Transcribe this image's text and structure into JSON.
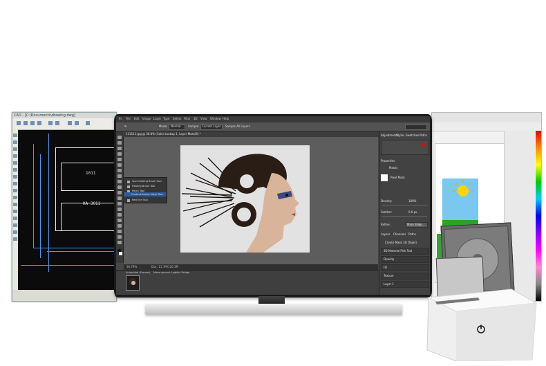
{
  "photoshop": {
    "menu": [
      "File",
      "Edit",
      "Image",
      "Layer",
      "Type",
      "Select",
      "Filter",
      "3D",
      "View",
      "Window",
      "Help"
    ],
    "options": {
      "mode_label": "Mode:",
      "mode_value": "Normal",
      "sample_label": "Sample:",
      "sample_value": "Current Layer",
      "checkbox_label": "Sample All Layers"
    },
    "tab_title": "111111.jpg @ 36.8% (Color Lookup 1, Layer Mask/8) *",
    "tool_flyout": [
      "Spot Healing Brush Tool",
      "Healing Brush Tool",
      "Patch Tool",
      "Content-Aware Move Tool",
      "Red Eye Tool"
    ],
    "status": {
      "zoom": "36.79%",
      "doc": "Doc: 11.7M/120.3M"
    },
    "timeline_tabs": [
      "Animation (Frames)",
      "Measurement Log",
      "Mini Bridge"
    ],
    "right_panel": {
      "tabs": [
        "Adjustments",
        "Styles",
        "Swatches",
        "Paths"
      ],
      "properties_title": "Properties",
      "mask_label": "Masks",
      "pixel_mask": "Pixel Mask",
      "density_label": "Density:",
      "density_value": "100%",
      "feather_label": "Feather:",
      "feather_value": "0.0 px",
      "refine_label": "Refine:",
      "mask_edge_btn": "Mask Edge...",
      "layers_tabs": [
        "Layers",
        "Channels",
        "Paths"
      ],
      "layer_group_title": "Create Mask 3D Object",
      "layer_rows": [
        "3D Material Pick Tool",
        "Opacity",
        "Fill",
        "Texture",
        "Layer 1"
      ]
    }
  },
  "cad": {
    "title": "CAD - [C:\\Documents\\drawing.dwg]",
    "labels": [
      "1011",
      "KA 3011"
    ]
  },
  "accent_colors": {
    "ps_highlight": "#2a5ba0",
    "cad_lines": "#3d9bff",
    "dock_power": "#222222"
  }
}
